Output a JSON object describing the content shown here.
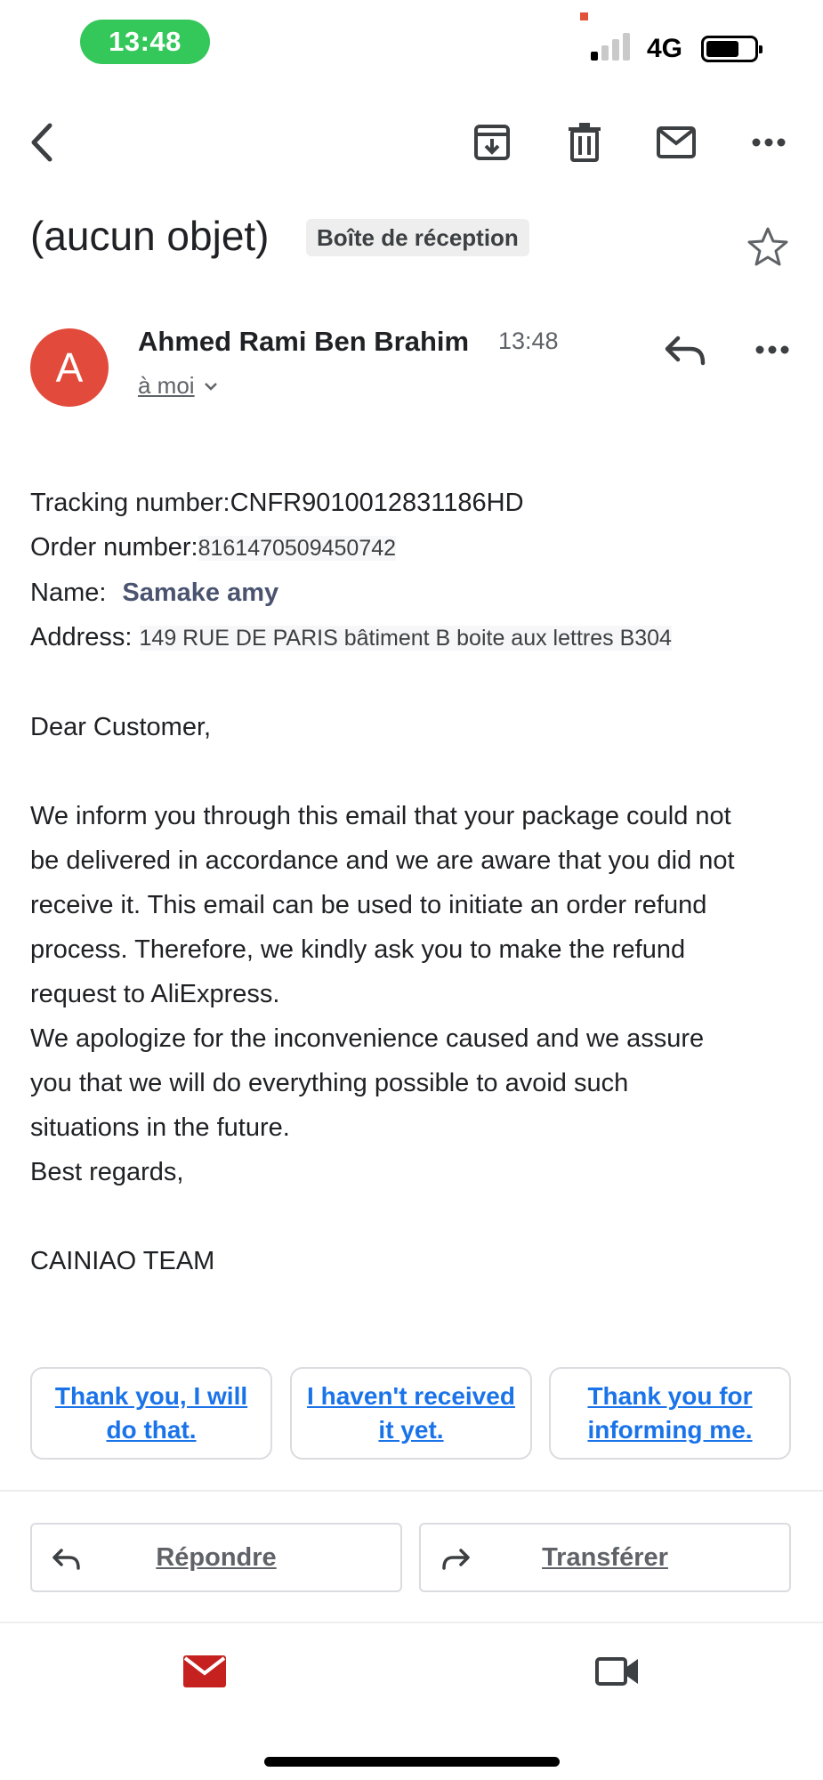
{
  "status_bar": {
    "time": "13:48",
    "network": "4G"
  },
  "toolbar": {
    "back_icon": "back-arrow-icon",
    "archive_icon": "archive-icon",
    "delete_icon": "trash-icon",
    "unread_icon": "mail-icon",
    "more_icon": "more-horizontal-icon"
  },
  "email": {
    "subject": "(aucun objet)",
    "label": "Boîte de réception",
    "sender": {
      "initial": "A",
      "name": "Ahmed Rami Ben Brahim",
      "time": "13:48",
      "recipient": "à moi",
      "avatar_color": "#e24a3b"
    },
    "body": {
      "tracking_label": "Tracking number:",
      "tracking_value": "CNFR9010012831186HD",
      "order_label": "Order number:",
      "order_value": "8161470509450742",
      "name_label": "Name:",
      "name_value": "Samake amy",
      "address_label": "Address:",
      "address_value": "149 RUE DE PARIS bâtiment B boite aux lettres B304",
      "greeting": "Dear Customer,",
      "paragraph_lines": [
        "We inform you through this email that your package could not",
        "be delivered in accordance and we are aware that you did not",
        "receive it. This email can be used to initiate an order refund",
        "process. Therefore, we kindly ask you to make the refund",
        "request to AliExpress.",
        "We apologize for the inconvenience caused and we assure",
        "you that we will do everything possible to avoid such",
        "situations in the future.",
        "Best regards,"
      ],
      "signature": "CAINIAO TEAM"
    }
  },
  "smart_replies": [
    "Thank you, I will do that.",
    "I haven't received it yet.",
    "Thank you for informing me."
  ],
  "actions": {
    "reply": "Répondre",
    "forward": "Transférer"
  },
  "colors": {
    "accent": "#1a73e8",
    "gmail_red": "#c5221f",
    "status_green": "#34c759"
  }
}
